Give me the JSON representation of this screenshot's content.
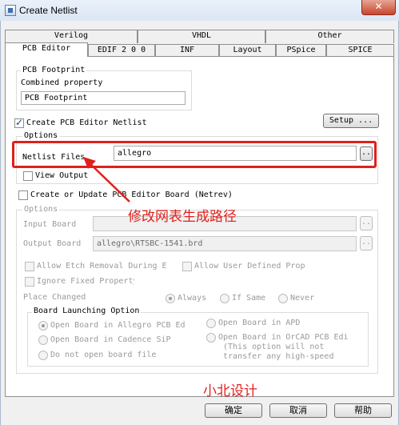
{
  "window": {
    "title": "Create Netlist",
    "close_glyph": "✕"
  },
  "tabs_row1": [
    "Verilog",
    "VHDL",
    "Other"
  ],
  "tabs_row2": [
    "PCB Editor",
    "EDIF 2 0 0",
    "INF",
    "Layout",
    "PSpice",
    "SPICE"
  ],
  "active_tab": "PCB Editor",
  "footprint": {
    "group_label": "PCB Footprint",
    "combined_label": "Combined property",
    "value": "PCB Footprint"
  },
  "create_netlist": {
    "label": "Create PCB Editor Netlist",
    "checked": true
  },
  "setup_label": "Setup ...",
  "options1": {
    "label": "Options",
    "netlist_files_label": "Netlist Files",
    "netlist_files_value": "allegro",
    "browse_label": "..",
    "view_output_label": "View Output",
    "view_output_checked": false
  },
  "create_board": {
    "label": "Create or Update PCB Editor Board (Netrev)",
    "checked": false
  },
  "options2": {
    "label": "Options",
    "input_board_label": "Input Board",
    "input_board_value": "",
    "output_board_label": "Output Board",
    "output_board_value": "allegro\\RTSBC-1541.brd",
    "browse_label": "..",
    "allow_etch_label": "Allow Etch Removal During E",
    "allow_user_label": "Allow User Defined Prop",
    "ignore_fixed_label": "Ignore Fixed Property",
    "place_changed_label": "Place Changed",
    "place_options": [
      "Always",
      "If Same",
      "Never"
    ],
    "place_selected": "Always"
  },
  "board_launch": {
    "label": "Board Launching Option",
    "open_allegro": "Open Board in Allegro PCB Ed",
    "open_apd": "Open Board in APD",
    "open_sip": "Open Board in Cadence SiP",
    "open_orcad": "Open Board in OrCAD PCB Edi",
    "orcad_note_1": "(This option will not",
    "orcad_note_2": "transfer any high-speed",
    "do_not_open": "Do not open board file",
    "selected": "open_allegro"
  },
  "annotations": {
    "arrow_text": "修改网表生成路径",
    "watermark": "小北设计",
    "color": "#e0201b"
  },
  "buttons": {
    "ok": "确定",
    "cancel": "取消",
    "help": "帮助"
  }
}
